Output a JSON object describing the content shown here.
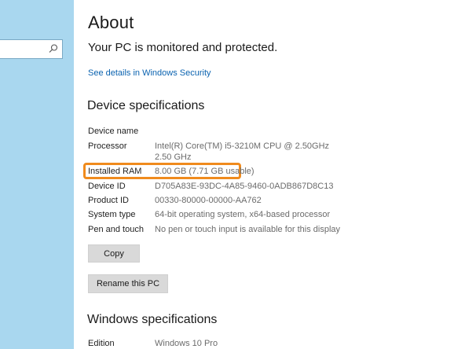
{
  "sidebar": {
    "search_icon": "search-icon"
  },
  "main": {
    "title": "About",
    "protection_status": "Your PC is monitored and protected.",
    "security_link": "See details in Windows Security"
  },
  "device_specs": {
    "heading": "Device specifications",
    "rows": [
      {
        "label": "Device name",
        "value": ""
      },
      {
        "label": "Processor",
        "value": "Intel(R) Core(TM) i5-3210M CPU @ 2.50GHz   2.50 GHz"
      },
      {
        "label": "Installed RAM",
        "value": "8.00 GB (7.71 GB usable)"
      },
      {
        "label": "Device ID",
        "value": "D705A83E-93DC-4A85-9460-0ADB867D8C13"
      },
      {
        "label": "Product ID",
        "value": "00330-80000-00000-AA762"
      },
      {
        "label": "System type",
        "value": "64-bit operating system, x64-based processor"
      },
      {
        "label": "Pen and touch",
        "value": "No pen or touch input is available for this display"
      }
    ],
    "copy_button": "Copy",
    "rename_button": "Rename this PC"
  },
  "windows_specs": {
    "heading": "Windows specifications",
    "rows": [
      {
        "label": "Edition",
        "value": "Windows 10 Pro"
      }
    ]
  },
  "colors": {
    "sidebar_bg": "#a9d7ef",
    "link": "#0b63b0",
    "highlight": "#f08b1d",
    "button_bg": "#d9d9d9"
  }
}
